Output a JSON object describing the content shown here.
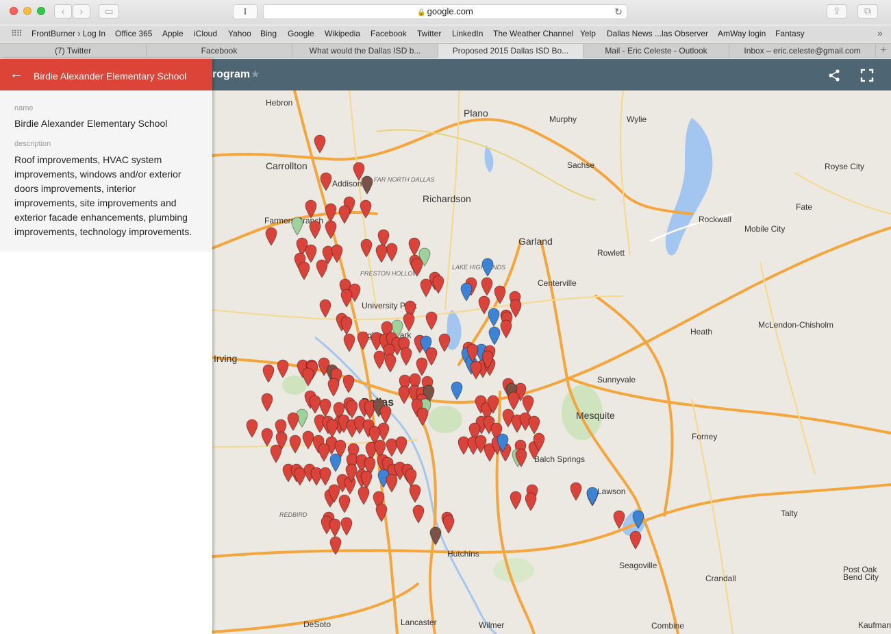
{
  "browser": {
    "url": "google.com",
    "text_cursor_glyph": "I",
    "favorites": [
      {
        "label": "FrontBurner › Log In"
      },
      {
        "label": "Office 365"
      },
      {
        "label": "Apple"
      },
      {
        "label": "iCloud"
      },
      {
        "label": "Yahoo"
      },
      {
        "label": "Bing"
      },
      {
        "label": "Google"
      },
      {
        "label": "Wikipedia"
      },
      {
        "label": "Facebook"
      },
      {
        "label": "Twitter"
      },
      {
        "label": "LinkedIn"
      },
      {
        "label": "The Weather Channel"
      },
      {
        "label": "Yelp"
      },
      {
        "label": "Dallas News ...las Observer"
      },
      {
        "label": "AmWay login"
      },
      {
        "label": "Fantasy"
      }
    ],
    "tabs": [
      {
        "label": "(7) Twitter"
      },
      {
        "label": "Facebook"
      },
      {
        "label": "What would the Dallas ISD b..."
      },
      {
        "label": "Proposed 2015 Dallas ISD Bo..."
      },
      {
        "label": "Mail - Eric Celeste - Outlook"
      },
      {
        "label": "Inbox – eric.celeste@gmail.com"
      }
    ],
    "active_tab_index": 3
  },
  "map_header": {
    "title_fragment": "rogram",
    "share_icon": "share-icon",
    "fullscreen_icon": "fullscreen-icon"
  },
  "panel": {
    "title": "Birdie Alexander Elementary School",
    "name_label": "name",
    "name_value": "Birdie Alexander Elementary School",
    "description_label": "description",
    "description_value": "Roof improvements, HVAC system improvements, windows and/or exterior doors improvements, interior improvements, site improvements and exterior facade enhancements, plumbing improvements, technology improvements."
  },
  "map": {
    "places": [
      {
        "name": "Hebron"
      },
      {
        "name": "Plano"
      },
      {
        "name": "Murphy"
      },
      {
        "name": "Wylie"
      },
      {
        "name": "Carrollton"
      },
      {
        "name": "Addison"
      },
      {
        "name": "FAR NORTH DALLAS"
      },
      {
        "name": "Sachse"
      },
      {
        "name": "Royse City"
      },
      {
        "name": "Richardson"
      },
      {
        "name": "Farmers Branch"
      },
      {
        "name": "Fate"
      },
      {
        "name": "Rockwall"
      },
      {
        "name": "Mobile City"
      },
      {
        "name": "Garland"
      },
      {
        "name": "Rowlett"
      },
      {
        "name": "PRESTON HOLLOW"
      },
      {
        "name": "LAKE HIGHLANDS"
      },
      {
        "name": "Centerville"
      },
      {
        "name": "University Park"
      },
      {
        "name": "Highland Park"
      },
      {
        "name": "McLendon-Chisholm"
      },
      {
        "name": "Heath"
      },
      {
        "name": "Irving"
      },
      {
        "name": "Sunnyvale"
      },
      {
        "name": "Dallas"
      },
      {
        "name": "Mesquite"
      },
      {
        "name": "Forney"
      },
      {
        "name": "Balch Springs"
      },
      {
        "name": "Lawson"
      },
      {
        "name": "Talty"
      },
      {
        "name": "REDBIRD"
      },
      {
        "name": "Hutchins"
      },
      {
        "name": "Seagoville"
      },
      {
        "name": "Post Oak Bend City"
      },
      {
        "name": "Crandall"
      },
      {
        "name": "DeSoto"
      },
      {
        "name": "Lancaster"
      },
      {
        "name": "Wilmer"
      },
      {
        "name": "Combine"
      },
      {
        "name": "Kaufman"
      }
    ],
    "marker_colors": {
      "red": "#d9433a",
      "blue": "#3c83d6",
      "green": "#9ed29a",
      "brown": "#7a5346"
    }
  },
  "colors": {
    "header_blue": "#4e6674",
    "panel_red": "#db4437",
    "highway": "#f4a53c"
  }
}
